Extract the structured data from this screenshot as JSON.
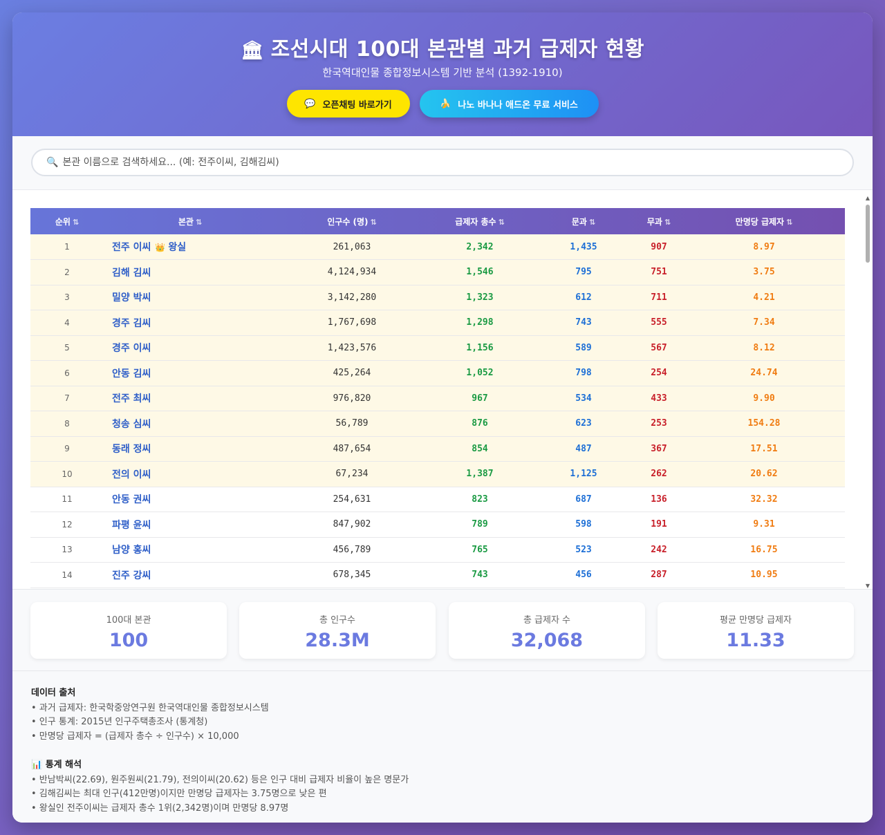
{
  "header": {
    "title": "조선시대 100대 본관별 과거 급제자 현황",
    "title_icon": "classical-building-icon",
    "subtitle": "한국역대인물 종합정보시스템 기반 분석 (1392-1910)",
    "buttons": [
      {
        "label": "오픈채팅 바로가기",
        "icon": "speech-bubble-icon",
        "color": "#fee500"
      },
      {
        "label": "나노 바나나 애드온 무료 서비스",
        "icon": "banana-icon",
        "color": "#1e90f5"
      }
    ]
  },
  "search": {
    "placeholder": "본관 이름으로 검색하세요... (예: 전주이씨, 김해김씨)",
    "icon": "magnifier-icon"
  },
  "table": {
    "headers": [
      "순위",
      "본관",
      "인구수 (명)",
      "급제자 총수",
      "문과",
      "무과",
      "만명당 급제자"
    ],
    "sort_icon": "⇅",
    "royal_badge": "왕실",
    "rows": [
      {
        "rank": "1",
        "name": "전주 이씨",
        "royal": true,
        "pop": "261,063",
        "total": "2,342",
        "mun": "1,435",
        "mu": "907",
        "per": "8.97"
      },
      {
        "rank": "2",
        "name": "김해 김씨",
        "pop": "4,124,934",
        "total": "1,546",
        "mun": "795",
        "mu": "751",
        "per": "3.75"
      },
      {
        "rank": "3",
        "name": "밀양 박씨",
        "pop": "3,142,280",
        "total": "1,323",
        "mun": "612",
        "mu": "711",
        "per": "4.21"
      },
      {
        "rank": "4",
        "name": "경주 김씨",
        "pop": "1,767,698",
        "total": "1,298",
        "mun": "743",
        "mu": "555",
        "per": "7.34"
      },
      {
        "rank": "5",
        "name": "경주 이씨",
        "pop": "1,423,576",
        "total": "1,156",
        "mun": "589",
        "mu": "567",
        "per": "8.12"
      },
      {
        "rank": "6",
        "name": "안동 김씨",
        "pop": "425,264",
        "total": "1,052",
        "mun": "798",
        "mu": "254",
        "per": "24.74"
      },
      {
        "rank": "7",
        "name": "전주 최씨",
        "pop": "976,820",
        "total": "967",
        "mun": "534",
        "mu": "433",
        "per": "9.90"
      },
      {
        "rank": "8",
        "name": "청송 심씨",
        "pop": "56,789",
        "total": "876",
        "mun": "623",
        "mu": "253",
        "per": "154.28"
      },
      {
        "rank": "9",
        "name": "동래 정씨",
        "pop": "487,654",
        "total": "854",
        "mun": "487",
        "mu": "367",
        "per": "17.51"
      },
      {
        "rank": "10",
        "name": "전의 이씨",
        "pop": "67,234",
        "total": "1,387",
        "mun": "1,125",
        "mu": "262",
        "per": "20.62"
      },
      {
        "rank": "11",
        "name": "안동 권씨",
        "pop": "254,631",
        "total": "823",
        "mun": "687",
        "mu": "136",
        "per": "32.32"
      },
      {
        "rank": "12",
        "name": "파평 윤씨",
        "pop": "847,902",
        "total": "789",
        "mun": "598",
        "mu": "191",
        "per": "9.31"
      },
      {
        "rank": "13",
        "name": "남양 홍씨",
        "pop": "456,789",
        "total": "765",
        "mun": "523",
        "mu": "242",
        "per": "16.75"
      },
      {
        "rank": "14",
        "name": "진주 강씨",
        "pop": "678,345",
        "total": "743",
        "mun": "456",
        "mu": "287",
        "per": "10.95"
      }
    ]
  },
  "stats": [
    {
      "label": "100대 본관",
      "value": "100"
    },
    {
      "label": "총 인구수",
      "value": "28.3M"
    },
    {
      "label": "총 급제자 수",
      "value": "32,068"
    },
    {
      "label": "평균 만명당 급제자",
      "value": "11.33"
    }
  ],
  "footer": {
    "source_title": "데이터 출처",
    "source_lines": [
      "• 과거 급제자: 한국학중앙연구원 한국역대인물 종합정보시스템",
      "• 인구 통계: 2015년 인구주택총조사 (통계청)",
      "• 만명당 급제자 = (급제자 총수 ÷ 인구수) × 10,000"
    ],
    "analysis_title": "통계 해석",
    "analysis_icon": "bar-chart-icon",
    "analysis_lines": [
      "• 반남박씨(22.69), 원주원씨(21.79), 전의이씨(20.62) 등은 인구 대비 급제자 비율이 높은 명문가",
      "• 김해김씨는 최대 인구(412만명)이지만 만명당 급제자는 3.75명으로 낮은 편",
      "• 왕실인 전주이씨는 급제자 총수 1위(2,342명)이며 만명당 8.97명"
    ]
  }
}
